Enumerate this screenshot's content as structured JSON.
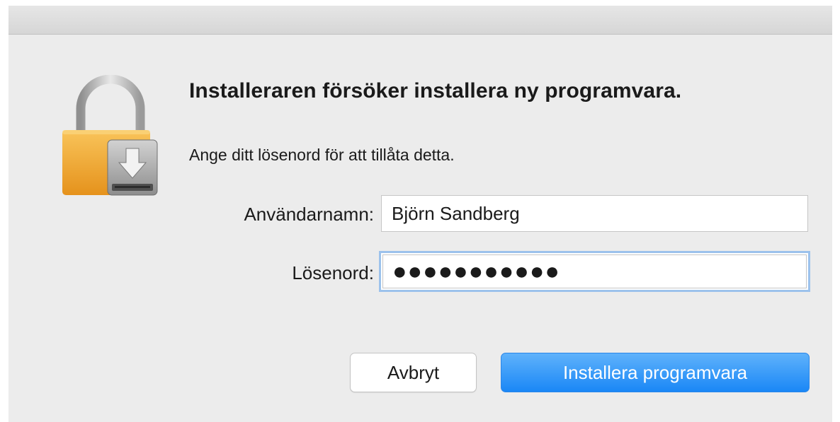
{
  "dialog": {
    "title": "Installeraren försöker installera ny programvara.",
    "message": "Ange ditt lösenord för att tillåta detta.",
    "icon": "lock-download-icon",
    "accent_color": "#1a87f6"
  },
  "form": {
    "username_label": "Användarnamn:",
    "username_value": "Björn Sandberg",
    "password_label": "Lösenord:",
    "password_value": "●●●●●●●●●●●"
  },
  "buttons": {
    "cancel_label": "Avbryt",
    "install_label": "Installera programvara"
  }
}
